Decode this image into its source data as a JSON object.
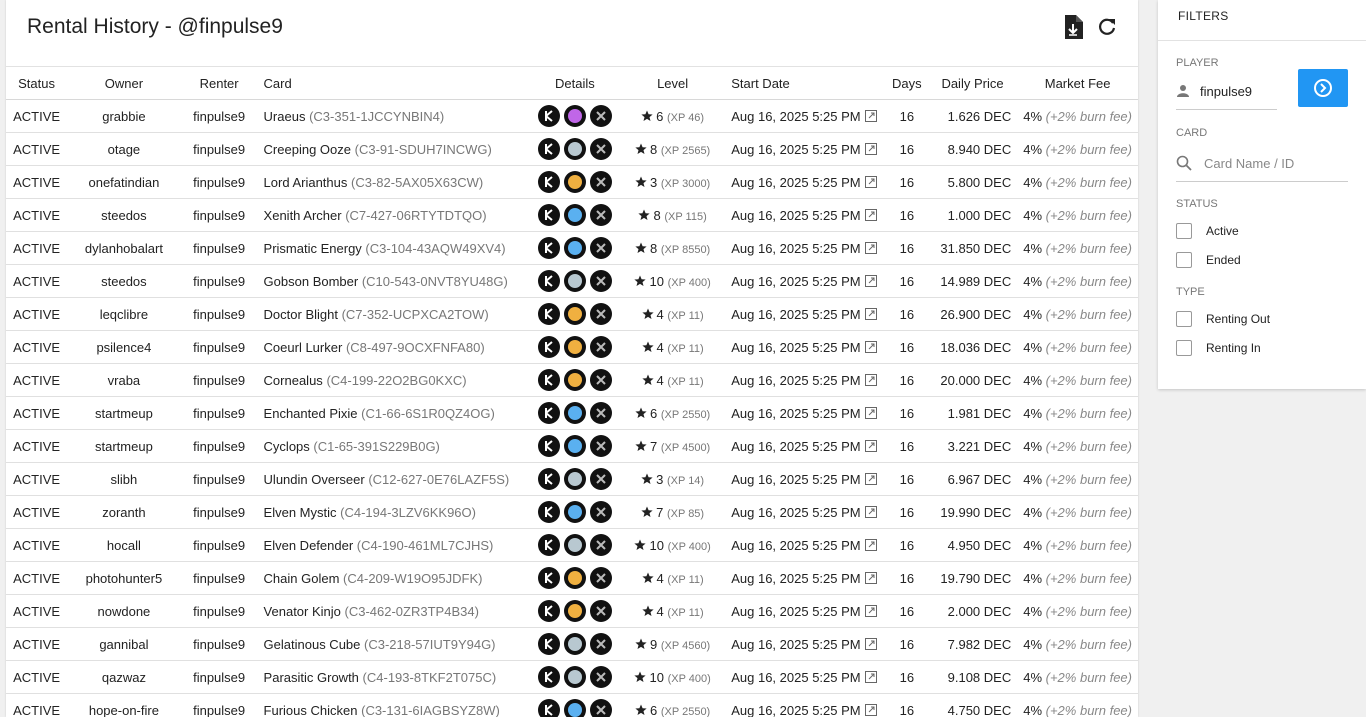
{
  "page": {
    "title": "Rental History - @finpulse9"
  },
  "table": {
    "headers": {
      "status": "Status",
      "owner": "Owner",
      "renter": "Renter",
      "card": "Card",
      "details": "Details",
      "level": "Level",
      "start_date": "Start Date",
      "days": "Days",
      "daily_price": "Daily Price",
      "market_fee": "Market Fee"
    },
    "rows": [
      {
        "status": "ACTIVE",
        "owner": "grabbie",
        "renter": "finpulse9",
        "card_name": "Uraeus",
        "card_id": "(C3-351-1JCCYNBIN4)",
        "element_color": "#c066e8",
        "level": "6",
        "xp": "(XP 46)",
        "start_date": "Aug 16, 2025 5:25 PM",
        "days": "16",
        "price": "1.626 DEC",
        "fee": "4%",
        "fee_note": "(+2% burn fee)"
      },
      {
        "status": "ACTIVE",
        "owner": "otage",
        "renter": "finpulse9",
        "card_name": "Creeping Ooze",
        "card_id": "(C3-91-SDUH7INCWG)",
        "element_color": "#b8c8d0",
        "level": "8",
        "xp": "(XP 2565)",
        "start_date": "Aug 16, 2025 5:25 PM",
        "days": "16",
        "price": "8.940 DEC",
        "fee": "4%",
        "fee_note": "(+2% burn fee)"
      },
      {
        "status": "ACTIVE",
        "owner": "onefatindian",
        "renter": "finpulse9",
        "card_name": "Lord Arianthus",
        "card_id": "(C3-82-5AX05X63CW)",
        "element_color": "#f0b040",
        "level": "3",
        "xp": "(XP 3000)",
        "start_date": "Aug 16, 2025 5:25 PM",
        "days": "16",
        "price": "5.800 DEC",
        "fee": "4%",
        "fee_note": "(+2% burn fee)"
      },
      {
        "status": "ACTIVE",
        "owner": "steedos",
        "renter": "finpulse9",
        "card_name": "Xenith Archer",
        "card_id": "(C7-427-06RTYTDTQO)",
        "element_color": "#5ab0f0",
        "level": "8",
        "xp": "(XP 115)",
        "start_date": "Aug 16, 2025 5:25 PM",
        "days": "16",
        "price": "1.000 DEC",
        "fee": "4%",
        "fee_note": "(+2% burn fee)"
      },
      {
        "status": "ACTIVE",
        "owner": "dylanhobalart",
        "renter": "finpulse9",
        "card_name": "Prismatic Energy",
        "card_id": "(C3-104-43AQW49XV4)",
        "element_color": "#5ab0f0",
        "level": "8",
        "xp": "(XP 8550)",
        "start_date": "Aug 16, 2025 5:25 PM",
        "days": "16",
        "price": "31.850 DEC",
        "fee": "4%",
        "fee_note": "(+2% burn fee)"
      },
      {
        "status": "ACTIVE",
        "owner": "steedos",
        "renter": "finpulse9",
        "card_name": "Gobson Bomber",
        "card_id": "(C10-543-0NVT8YU48G)",
        "element_color": "#b8c8d0",
        "level": "10",
        "xp": "(XP 400)",
        "start_date": "Aug 16, 2025 5:25 PM",
        "days": "16",
        "price": "14.989 DEC",
        "fee": "4%",
        "fee_note": "(+2% burn fee)"
      },
      {
        "status": "ACTIVE",
        "owner": "leqclibre",
        "renter": "finpulse9",
        "card_name": "Doctor Blight",
        "card_id": "(C7-352-UCPXCA2TOW)",
        "element_color": "#f0b040",
        "level": "4",
        "xp": "(XP 11)",
        "start_date": "Aug 16, 2025 5:25 PM",
        "days": "16",
        "price": "26.900 DEC",
        "fee": "4%",
        "fee_note": "(+2% burn fee)"
      },
      {
        "status": "ACTIVE",
        "owner": "psilence4",
        "renter": "finpulse9",
        "card_name": "Coeurl Lurker",
        "card_id": "(C8-497-9OCXFNFA80)",
        "element_color": "#f0b040",
        "level": "4",
        "xp": "(XP 11)",
        "start_date": "Aug 16, 2025 5:25 PM",
        "days": "16",
        "price": "18.036 DEC",
        "fee": "4%",
        "fee_note": "(+2% burn fee)"
      },
      {
        "status": "ACTIVE",
        "owner": "vraba",
        "renter": "finpulse9",
        "card_name": "Cornealus",
        "card_id": "(C4-199-22O2BG0KXC)",
        "element_color": "#f0b040",
        "level": "4",
        "xp": "(XP 11)",
        "start_date": "Aug 16, 2025 5:25 PM",
        "days": "16",
        "price": "20.000 DEC",
        "fee": "4%",
        "fee_note": "(+2% burn fee)"
      },
      {
        "status": "ACTIVE",
        "owner": "startmeup",
        "renter": "finpulse9",
        "card_name": "Enchanted Pixie",
        "card_id": "(C1-66-6S1R0QZ4OG)",
        "element_color": "#5ab0f0",
        "level": "6",
        "xp": "(XP 2550)",
        "start_date": "Aug 16, 2025 5:25 PM",
        "days": "16",
        "price": "1.981 DEC",
        "fee": "4%",
        "fee_note": "(+2% burn fee)"
      },
      {
        "status": "ACTIVE",
        "owner": "startmeup",
        "renter": "finpulse9",
        "card_name": "Cyclops",
        "card_id": "(C1-65-391S229B0G)",
        "element_color": "#5ab0f0",
        "level": "7",
        "xp": "(XP 4500)",
        "start_date": "Aug 16, 2025 5:25 PM",
        "days": "16",
        "price": "3.221 DEC",
        "fee": "4%",
        "fee_note": "(+2% burn fee)"
      },
      {
        "status": "ACTIVE",
        "owner": "slibh",
        "renter": "finpulse9",
        "card_name": "Ulundin Overseer",
        "card_id": "(C12-627-0E76LAZF5S)",
        "element_color": "#b8c8d0",
        "level": "3",
        "xp": "(XP 14)",
        "start_date": "Aug 16, 2025 5:25 PM",
        "days": "16",
        "price": "6.967 DEC",
        "fee": "4%",
        "fee_note": "(+2% burn fee)"
      },
      {
        "status": "ACTIVE",
        "owner": "zoranth",
        "renter": "finpulse9",
        "card_name": "Elven Mystic",
        "card_id": "(C4-194-3LZV6KK96O)",
        "element_color": "#5ab0f0",
        "level": "7",
        "xp": "(XP 85)",
        "start_date": "Aug 16, 2025 5:25 PM",
        "days": "16",
        "price": "19.990 DEC",
        "fee": "4%",
        "fee_note": "(+2% burn fee)"
      },
      {
        "status": "ACTIVE",
        "owner": "hocall",
        "renter": "finpulse9",
        "card_name": "Elven Defender",
        "card_id": "(C4-190-461ML7CJHS)",
        "element_color": "#b8c8d0",
        "level": "10",
        "xp": "(XP 400)",
        "start_date": "Aug 16, 2025 5:25 PM",
        "days": "16",
        "price": "4.950 DEC",
        "fee": "4%",
        "fee_note": "(+2% burn fee)"
      },
      {
        "status": "ACTIVE",
        "owner": "photohunter5",
        "renter": "finpulse9",
        "card_name": "Chain Golem",
        "card_id": "(C4-209-W19O95JDFK)",
        "element_color": "#f0b040",
        "level": "4",
        "xp": "(XP 11)",
        "start_date": "Aug 16, 2025 5:25 PM",
        "days": "16",
        "price": "19.790 DEC",
        "fee": "4%",
        "fee_note": "(+2% burn fee)"
      },
      {
        "status": "ACTIVE",
        "owner": "nowdone",
        "renter": "finpulse9",
        "card_name": "Venator Kinjo",
        "card_id": "(C3-462-0ZR3TP4B34)",
        "element_color": "#f0b040",
        "level": "4",
        "xp": "(XP 11)",
        "start_date": "Aug 16, 2025 5:25 PM",
        "days": "16",
        "price": "2.000 DEC",
        "fee": "4%",
        "fee_note": "(+2% burn fee)"
      },
      {
        "status": "ACTIVE",
        "owner": "gannibal",
        "renter": "finpulse9",
        "card_name": "Gelatinous Cube",
        "card_id": "(C3-218-57IUT9Y94G)",
        "element_color": "#b8c8d0",
        "level": "9",
        "xp": "(XP 4560)",
        "start_date": "Aug 16, 2025 5:25 PM",
        "days": "16",
        "price": "7.982 DEC",
        "fee": "4%",
        "fee_note": "(+2% burn fee)"
      },
      {
        "status": "ACTIVE",
        "owner": "qazwaz",
        "renter": "finpulse9",
        "card_name": "Parasitic Growth",
        "card_id": "(C4-193-8TKF2T075C)",
        "element_color": "#b8c8d0",
        "level": "10",
        "xp": "(XP 400)",
        "start_date": "Aug 16, 2025 5:25 PM",
        "days": "16",
        "price": "9.108 DEC",
        "fee": "4%",
        "fee_note": "(+2% burn fee)"
      },
      {
        "status": "ACTIVE",
        "owner": "hope-on-fire",
        "renter": "finpulse9",
        "card_name": "Furious Chicken",
        "card_id": "(C3-131-6IAGBSYZ8W)",
        "element_color": "#5ab0f0",
        "level": "6",
        "xp": "(XP 2550)",
        "start_date": "Aug 16, 2025 5:25 PM",
        "days": "16",
        "price": "4.750 DEC",
        "fee": "4%",
        "fee_note": "(+2% burn fee)"
      }
    ]
  },
  "filters": {
    "title": "FILTERS",
    "player_label": "PLAYER",
    "player_value": "finpulse9",
    "card_label": "CARD",
    "card_placeholder": "Card Name / ID",
    "status_label": "STATUS",
    "status_options": [
      "Active",
      "Ended"
    ],
    "type_label": "TYPE",
    "type_options": [
      "Renting Out",
      "Renting In"
    ]
  },
  "colors": {
    "accent": "#2196f3"
  }
}
